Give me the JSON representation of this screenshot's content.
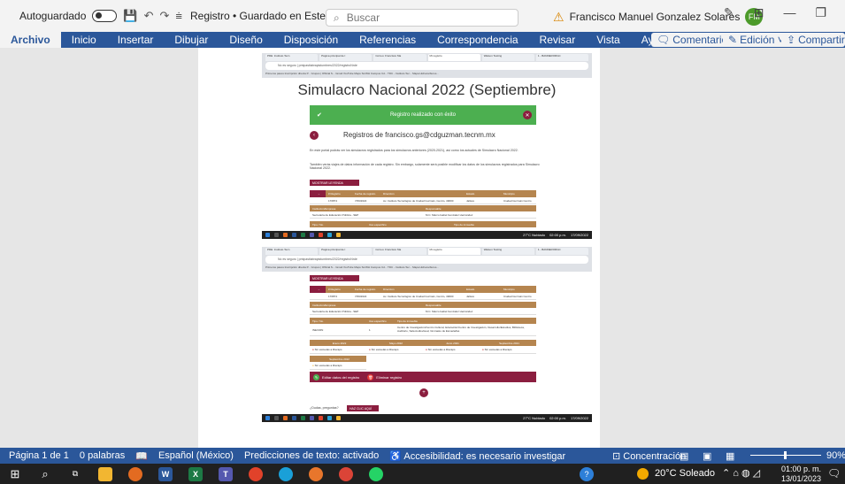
{
  "titlebar": {
    "autosave": "Autoguardado",
    "doc_title": "Registro • Guardado en Este PC ∨",
    "search_placeholder": "Buscar",
    "user_name": "Francisco Manuel Gonzalez Solares",
    "user_initials": "FM"
  },
  "ribbon": {
    "tabs": [
      "Archivo",
      "Inicio",
      "Insertar",
      "Dibujar",
      "Diseño",
      "Disposición",
      "Referencias",
      "Correspondencia",
      "Revisar",
      "Vista",
      "Ayuda"
    ],
    "comments": "Comentarios",
    "editing": "Edición ˅",
    "share": "Compartir ˅"
  },
  "shot1": {
    "tabs": [
      "PDE: Instituto Tecn",
      "Página principal de I",
      "Correo: Francisco Ma",
      "Mi registro",
      "Watson Testing",
      "1 - BANNERORGC"
    ],
    "url": "No es seguro | pmipastiabrapistumbres/2022/registroNrde",
    "bookmarks": "Primeros pasos   Inscripción directa P...   Grupos | Official S...   Gmail   YouTube   Maps   SmWH Campus Cd...   TDC - Instituto Tec...   Mapa Hidrocarburos...",
    "heading": "Simulacro Nacional 2022 (Septiembre)",
    "banner": "Registro realizado con éxito",
    "subhead": "Registros de francisco.gs@cdguzman.tecnm.mx",
    "para1": "En este portal podrás ver los simulacros registrados para los simulacros anteriores (2020-2021), así como los actuales de Simulacro Nacional 2022.",
    "para2": "También verás viajes de datos información de cada registro. Sin embargo, solamente será posible modificar los datos de los simulacros registrados para Simulacro Nacional 2022.",
    "legend_btn": "MOSTRAR LEYENDA",
    "headers": [
      "# Registro",
      "Fecha de registro",
      "Dirección",
      "Estado",
      "Municipio"
    ],
    "row": [
      "170874",
      "7/09/2022",
      "Av. Instituto Tecnológico de Ciudad Guzmán, Centro, 49000",
      "Jalisco",
      "Ciudad Guzmán Centro"
    ],
    "headers2": [
      "Institución/Empresa",
      "Responsable"
    ],
    "row2": [
      "Secretaría de Educación Pública - SEP",
      "M.C. Marco Isabel Gonzalez Hernández"
    ],
    "headers3": [
      "Tipo / No.",
      "Uso específico",
      "Tipo de inmueble"
    ]
  },
  "shot2": {
    "tabs": [
      "PDE: Instituto Tecn",
      "Página principal de I",
      "Correo: Francisco Ma",
      "Mi registro",
      "Watson Testing",
      "1 - BANNERORGC"
    ],
    "legend_btn": "MOSTRAR LEYENDA",
    "headers": [
      "# Registro",
      "Fecha de registro",
      "Dirección",
      "Estado",
      "Municipio"
    ],
    "row": [
      "170874",
      "7/09/2022",
      "Av. Instituto Tecnológico de Ciudad Guzmán, Centro, 49000",
      "Jalisco",
      "Ciudad Guzmán Centro"
    ],
    "headers2": [
      "Institución/Empresa",
      "Responsable"
    ],
    "row2": [
      "Secretaría de Educación Pública - SEP",
      "M.C. Marco Isabel Gonzalez Hernández"
    ],
    "headers3": [
      "Tipo / No.",
      "Uso específico",
      "Tipo de inmueble"
    ],
    "row3": [
      "INE/CDN",
      "1",
      "Centro de Investigación/Centro Cultural, Educación/Centro de Investigación, Desarrollo/Estudios, Biblioteca, Auditorio, Sala Audiovisual, Gimnasio de Escuela/las"
    ],
    "months": [
      "Enero 2022",
      "Mayo 2022",
      "Junio 2021",
      "Septiembre 2021"
    ],
    "status": [
      "Sin escuelas a liberaps",
      "Sin escuelas a liberaps",
      "Sin escuelas a liberaps",
      "Sin escuelas a liberaps"
    ],
    "month2": "Septiembre 2022",
    "status2": "Sin escuelas a liberaps",
    "edit_btn": "Editar datos del registro",
    "delete_btn": "Eliminar registro",
    "doubt": "¿Dudas, preguntas?",
    "help_btn": "HAZ CLIC AQUÍ"
  },
  "mini_taskbar": {
    "weather": "27°C Nublado",
    "time": "02:00 p.m.",
    "date": "17/09/2022"
  },
  "statusbar": {
    "page": "Página 1 de 1",
    "words": "0 palabras",
    "lang": "Español (México)",
    "pred": "Predicciones de texto: activado",
    "access": "Accesibilidad: es necesario investigar",
    "focus": "Concentración",
    "zoom": "90%"
  },
  "taskbar": {
    "weather": "20°C Soleado",
    "time": "01:00 p. m.",
    "date": "13/01/2023"
  }
}
